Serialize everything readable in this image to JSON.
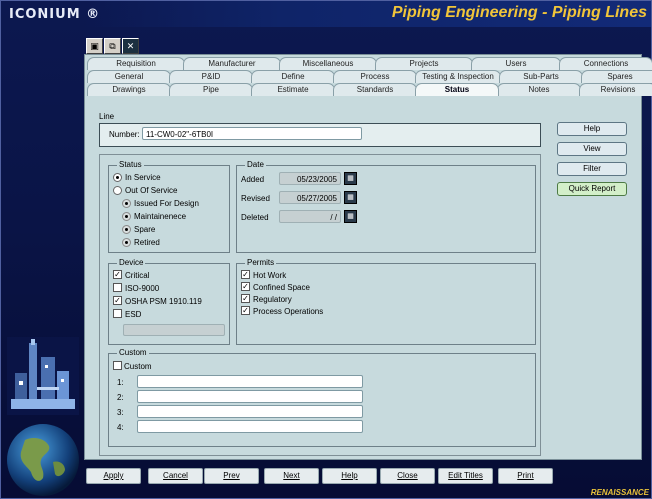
{
  "app": {
    "logo": "ICONIUM ®",
    "title": "Piping Engineering - Piping Lines",
    "brand": "RENAISSANCE"
  },
  "toolbar": {
    "icons": [
      "open-icon",
      "copy-icon",
      "close-icon"
    ]
  },
  "tabs": {
    "row1": [
      "Requisition",
      "Manufacturer",
      "Miscellaneous",
      "Projects",
      "Users",
      "Connections"
    ],
    "row2": [
      "General",
      "P&ID",
      "Define",
      "Process",
      "Testing & Inspection",
      "Sub-Parts",
      "Spares"
    ],
    "row3": [
      "Drawings",
      "Pipe",
      "Estimate",
      "Standards",
      "Status",
      "Notes",
      "Revisions"
    ],
    "active": "Status"
  },
  "line": {
    "group_label": "Line",
    "number_label": "Number:",
    "number_value": "11-CW0-02\"-6TB0I"
  },
  "status": {
    "title": "Status",
    "in_service": "In Service",
    "out_of_service": "Out Of Service",
    "sub_options": [
      "Issued For Design",
      "Maintainenece",
      "Spare",
      "Retired"
    ]
  },
  "date": {
    "title": "Date",
    "added_label": "Added",
    "added_value": "05/23/2005",
    "revised_label": "Revised",
    "revised_value": "05/27/2005",
    "deleted_label": "Deleted",
    "deleted_value": "/ /"
  },
  "device": {
    "title": "Device",
    "items": [
      {
        "label": "Critical",
        "checked": true
      },
      {
        "label": "ISO-9000",
        "checked": false
      },
      {
        "label": "OSHA PSM 1910.119",
        "checked": true
      },
      {
        "label": "ESD",
        "checked": false
      }
    ]
  },
  "permits": {
    "title": "Permits",
    "items": [
      {
        "label": "Hot Work",
        "checked": true
      },
      {
        "label": "Confined Space",
        "checked": true
      },
      {
        "label": "Regulatory",
        "checked": true
      },
      {
        "label": "Process Operations",
        "checked": true
      }
    ]
  },
  "custom": {
    "title": "Custom",
    "check_label": "Custom",
    "fields": [
      {
        "label": "1:",
        "value": ""
      },
      {
        "label": "2:",
        "value": ""
      },
      {
        "label": "3:",
        "value": ""
      },
      {
        "label": "4:",
        "value": ""
      }
    ]
  },
  "side_buttons": {
    "help": "Help",
    "view": "View",
    "filter": "Filter",
    "quick_report": "Quick Report"
  },
  "bottom_buttons": {
    "apply": "Apply",
    "cancel": "Cancel",
    "prev": "Prev",
    "next": "Next",
    "help": "Help",
    "close": "Close",
    "edit_titles": "Edit Titles",
    "print": "Print"
  },
  "colors": {
    "title": "#f0c53a",
    "panel": "#c7dadd",
    "background": "#070d3a"
  }
}
